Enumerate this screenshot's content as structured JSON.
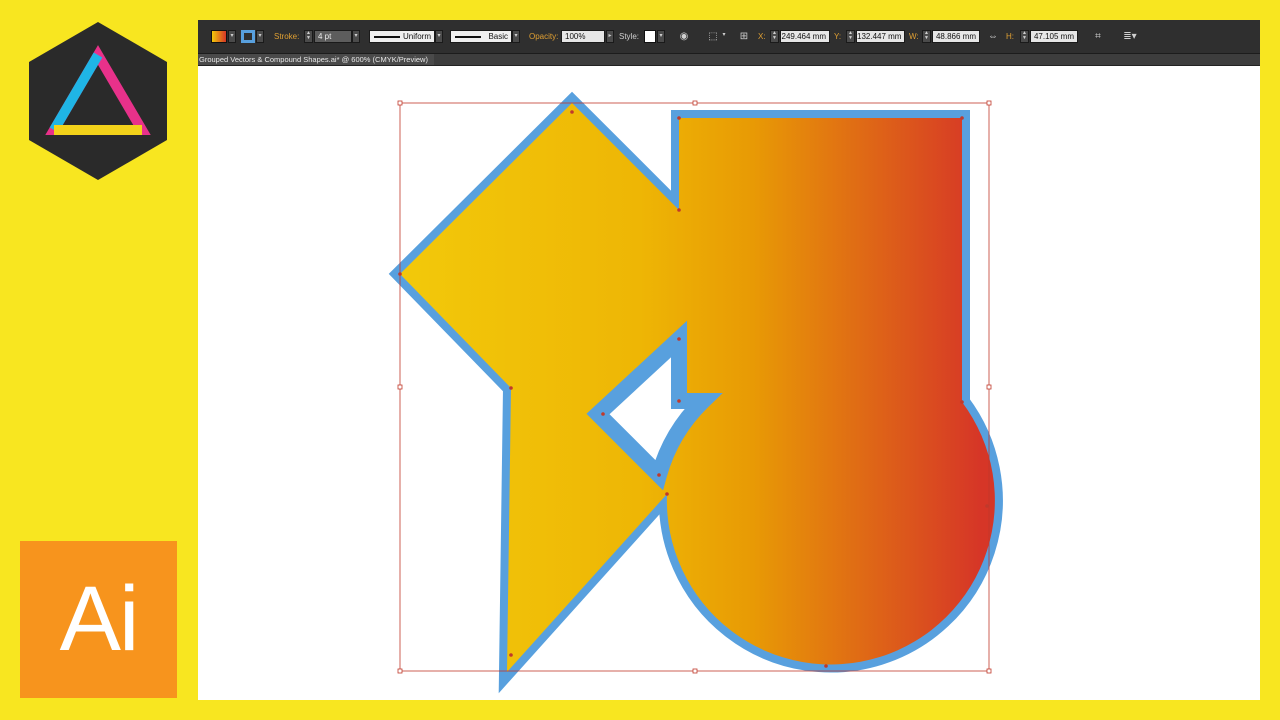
{
  "brand": {
    "badge_icon": "triangle-logo-icon",
    "app_logo_text": "Ai"
  },
  "colors": {
    "background": "#f8e620",
    "gradient_start": "#f2c80a",
    "gradient_mid": "#e89a05",
    "gradient_end": "#d63627",
    "stroke": "#58a0de",
    "selection": "#c0392b",
    "app_logo": "#f7941d"
  },
  "control_bar": {
    "stroke_label": "Stroke:",
    "stroke_weight": "4 pt",
    "profile": "Uniform",
    "brush": "Basic",
    "opacity_label": "Opacity:",
    "opacity_value": "100%",
    "style_label": "Style:",
    "x_label": "X:",
    "x_value": "249.464 mm",
    "y_label": "Y:",
    "y_value": "132.447 mm",
    "w_label": "W:",
    "w_value": "48.866 mm",
    "h_label": "H:",
    "h_value": "47.105 mm"
  },
  "document": {
    "tab_title": "Grouped Vectors & Compound Shapes.ai* @ 600% (CMYK/Preview)"
  }
}
